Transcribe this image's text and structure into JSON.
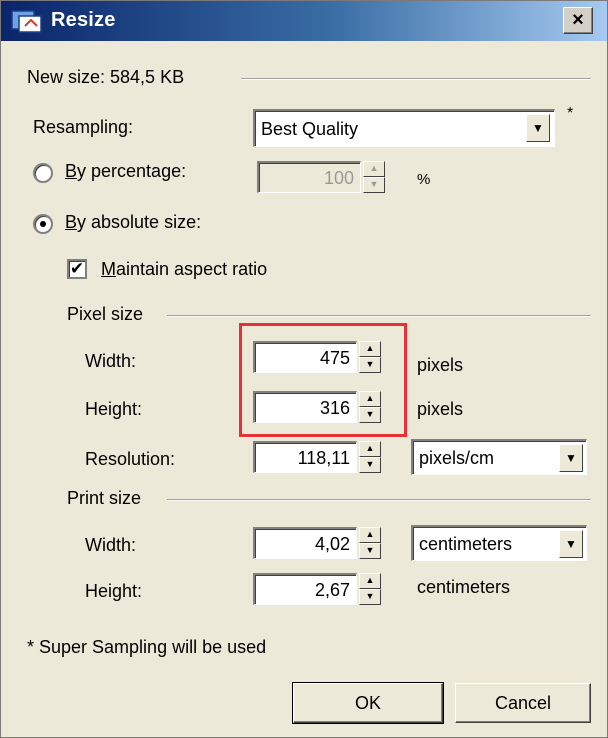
{
  "window": {
    "title": "Resize",
    "close_label": "×"
  },
  "new_size": {
    "label": "New size: 584,5 KB"
  },
  "resampling": {
    "label": "Resampling:",
    "value": "Best Quality",
    "asterisk": "*"
  },
  "by_percentage": {
    "label_underline": "B",
    "label_rest": "y percentage:",
    "value": "100",
    "unit": "%",
    "selected": false
  },
  "by_absolute": {
    "label_underline": "B",
    "label_rest": "y absolute size:",
    "selected": true
  },
  "maintain_aspect": {
    "label_underline": "M",
    "label_rest": "aintain aspect ratio",
    "checked": true,
    "check_mark": "✔"
  },
  "pixel_size": {
    "heading": "Pixel size",
    "width_label": "Width:",
    "width_value": "475",
    "width_unit": "pixels",
    "height_label": "Height:",
    "height_value": "316",
    "height_unit": "pixels",
    "resolution_label": "Resolution:",
    "resolution_value": "118,11",
    "resolution_unit": "pixels/cm"
  },
  "print_size": {
    "heading": "Print size",
    "width_label": "Width:",
    "width_value": "4,02",
    "width_unit": "centimeters",
    "height_label": "Height:",
    "height_value": "2,67",
    "height_unit": "centimeters"
  },
  "footnote": "* Super Sampling will be used",
  "buttons": {
    "ok": "OK",
    "cancel": "Cancel"
  },
  "icons": {
    "spin_up": "▲",
    "spin_down": "▼",
    "dropdown": "▼"
  },
  "colors": {
    "highlight_box": "#e53238",
    "title_bar_start": "#0a246a",
    "title_bar_end": "#a6caf0"
  }
}
